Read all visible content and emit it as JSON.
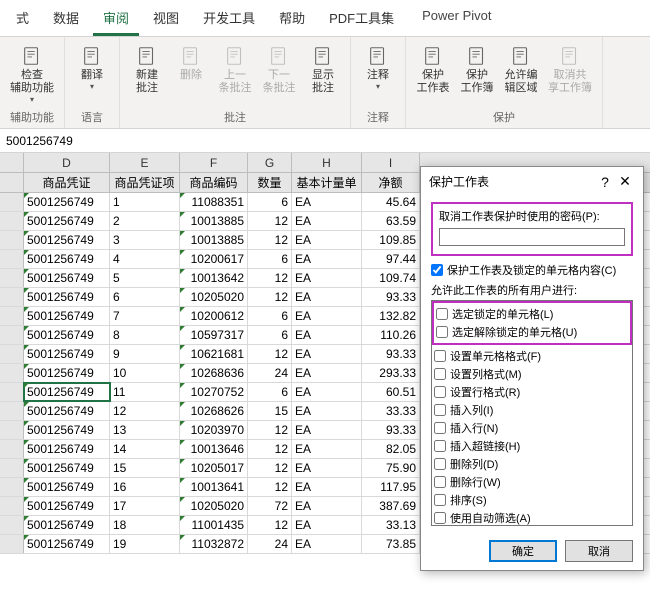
{
  "tabs": [
    "式",
    "数据",
    "审阅",
    "视图",
    "开发工具",
    "帮助",
    "PDF工具集",
    "Power Pivot"
  ],
  "active_tab_index": 2,
  "ribbon": {
    "groups": [
      {
        "label": "辅助功能",
        "items": [
          {
            "label": "检查\n辅助功能",
            "dd": true
          }
        ]
      },
      {
        "label": "语言",
        "items": [
          {
            "label": "翻译",
            "dd": true
          }
        ]
      },
      {
        "label": "批注",
        "items": [
          {
            "label": "新建\n批注"
          },
          {
            "label": "删除",
            "disabled": true
          },
          {
            "label": "上一\n条批注",
            "disabled": true
          },
          {
            "label": "下一\n条批注",
            "disabled": true
          },
          {
            "label": "显示\n批注"
          }
        ]
      },
      {
        "label": "注释",
        "items": [
          {
            "label": "注释",
            "dd": true
          }
        ]
      },
      {
        "label": "保护",
        "items": [
          {
            "label": "保护\n工作表"
          },
          {
            "label": "保护\n工作簿"
          },
          {
            "label": "允许编\n辑区域"
          },
          {
            "label": "取消共\n享工作簿",
            "disabled": true
          }
        ]
      }
    ]
  },
  "formula_bar": "5001256749",
  "col_letters": [
    "D",
    "E",
    "F",
    "G",
    "H",
    "I"
  ],
  "col_headers": [
    "商品凭证",
    "商品凭证项",
    "商品编码",
    "数量",
    "基本计量单",
    "净额"
  ],
  "rows": [
    {
      "d": "5001256749",
      "e": "1",
      "f": "11088351",
      "g": "6",
      "h": "EA",
      "i": "45.64"
    },
    {
      "d": "5001256749",
      "e": "2",
      "f": "10013885",
      "g": "12",
      "h": "EA",
      "i": "63.59"
    },
    {
      "d": "5001256749",
      "e": "3",
      "f": "10013885",
      "g": "12",
      "h": "EA",
      "i": "109.85"
    },
    {
      "d": "5001256749",
      "e": "4",
      "f": "10200617",
      "g": "6",
      "h": "EA",
      "i": "97.44"
    },
    {
      "d": "5001256749",
      "e": "5",
      "f": "10013642",
      "g": "12",
      "h": "EA",
      "i": "109.74"
    },
    {
      "d": "5001256749",
      "e": "6",
      "f": "10205020",
      "g": "12",
      "h": "EA",
      "i": "93.33"
    },
    {
      "d": "5001256749",
      "e": "7",
      "f": "10200612",
      "g": "6",
      "h": "EA",
      "i": "132.82"
    },
    {
      "d": "5001256749",
      "e": "8",
      "f": "10597317",
      "g": "6",
      "h": "EA",
      "i": "110.26"
    },
    {
      "d": "5001256749",
      "e": "9",
      "f": "10621681",
      "g": "12",
      "h": "EA",
      "i": "93.33"
    },
    {
      "d": "5001256749",
      "e": "10",
      "f": "10268636",
      "g": "24",
      "h": "EA",
      "i": "293.33"
    },
    {
      "d": "5001256749",
      "e": "11",
      "f": "10270752",
      "g": "6",
      "h": "EA",
      "i": "60.51"
    },
    {
      "d": "5001256749",
      "e": "12",
      "f": "10268626",
      "g": "15",
      "h": "EA",
      "i": "33.33"
    },
    {
      "d": "5001256749",
      "e": "13",
      "f": "10203970",
      "g": "12",
      "h": "EA",
      "i": "93.33"
    },
    {
      "d": "5001256749",
      "e": "14",
      "f": "10013646",
      "g": "12",
      "h": "EA",
      "i": "82.05"
    },
    {
      "d": "5001256749",
      "e": "15",
      "f": "10205017",
      "g": "12",
      "h": "EA",
      "i": "75.90"
    },
    {
      "d": "5001256749",
      "e": "16",
      "f": "10013641",
      "g": "12",
      "h": "EA",
      "i": "117.95"
    },
    {
      "d": "5001256749",
      "e": "17",
      "f": "10205020",
      "g": "72",
      "h": "EA",
      "i": "387.69"
    },
    {
      "d": "5001256749",
      "e": "18",
      "f": "11001435",
      "g": "12",
      "h": "EA",
      "i": "33.13"
    },
    {
      "d": "5001256749",
      "e": "19",
      "f": "11032872",
      "g": "24",
      "h": "EA",
      "i": "73.85"
    }
  ],
  "selected_row_index": 10,
  "dialog": {
    "title": "保护工作表",
    "help": "?",
    "close": "✕",
    "password_label": "取消工作表保护时使用的密码(P):",
    "password_value": "",
    "protect_content": "保护工作表及锁定的单元格内容(C)",
    "perm_label": "允许此工作表的所有用户进行:",
    "perms": [
      "选定锁定的单元格(L)",
      "选定解除锁定的单元格(U)",
      "设置单元格格式(F)",
      "设置列格式(M)",
      "设置行格式(R)",
      "插入列(I)",
      "插入行(N)",
      "插入超链接(H)",
      "删除列(D)",
      "删除行(W)",
      "排序(S)",
      "使用自动筛选(A)"
    ],
    "ok": "确定",
    "cancel": "取消"
  }
}
